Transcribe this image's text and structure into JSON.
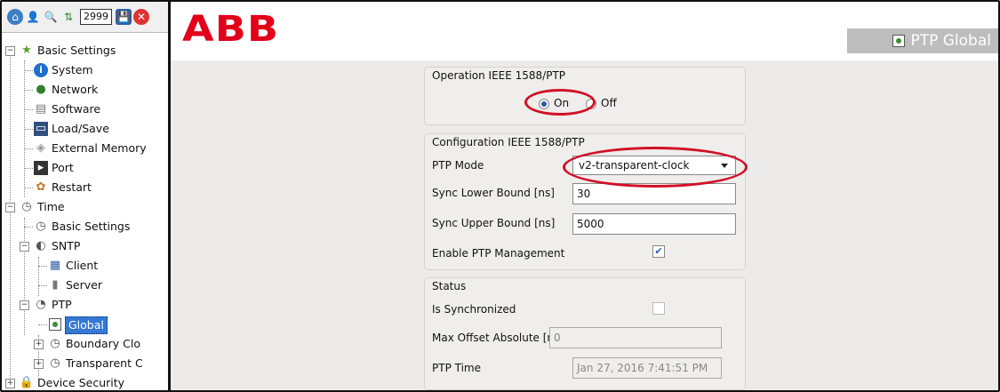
{
  "toolbar": {
    "counter": "2999",
    "icons": [
      "home-icon",
      "users-icon",
      "search-icon",
      "transfer-icon",
      "save-icon",
      "close-icon"
    ]
  },
  "tree": {
    "basic_settings": "Basic Settings",
    "system": "System",
    "network": "Network",
    "software": "Software",
    "load_save": "Load/Save",
    "external_memory": "External Memory",
    "port": "Port",
    "restart": "Restart",
    "time": "Time",
    "time_basic_settings": "Basic Settings",
    "sntp": "SNTP",
    "client": "Client",
    "server": "Server",
    "ptp": "PTP",
    "global": "Global",
    "boundary_clock": "Boundary Clo",
    "transparent_clock": "Transparent C",
    "device_security": "Device Security"
  },
  "header": {
    "logo": "ABB",
    "page_label": "PTP Global"
  },
  "operation": {
    "title": "Operation IEEE 1588/PTP",
    "on_label": "On",
    "off_label": "Off",
    "selected": "On"
  },
  "config": {
    "title": "Configuration IEEE 1588/PTP",
    "ptp_mode_label": "PTP Mode",
    "ptp_mode_value": "v2-transparent-clock",
    "sync_lower_label": "Sync Lower Bound [ns]",
    "sync_lower_value": "30",
    "sync_upper_label": "Sync Upper Bound [ns]",
    "sync_upper_value": "5000",
    "enable_mgmt_label": "Enable PTP Management",
    "enable_mgmt_checked": true
  },
  "status": {
    "title": "Status",
    "synchronized_label": "Is Synchronized",
    "synchronized_checked": false,
    "max_offset_label": "Max Offset Absolute [ns]",
    "max_offset_value": "0",
    "ptp_time_label": "PTP Time",
    "ptp_time_value": "Jan 27, 2016 7:41:51 PM"
  },
  "colors": {
    "abb_red": "#e2001a",
    "highlight_red": "#d20f26",
    "selection_blue": "#3478d4"
  }
}
